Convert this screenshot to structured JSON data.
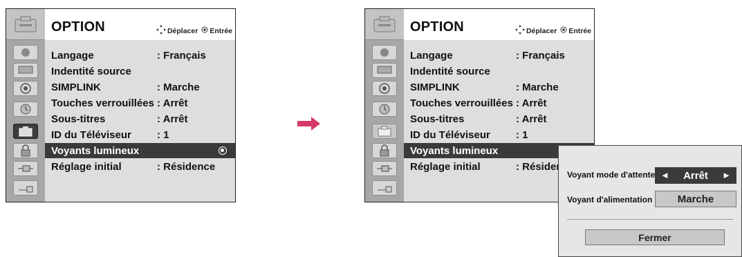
{
  "menu": {
    "title": "OPTION",
    "hint_move": "Déplacer",
    "hint_enter": "Entrée",
    "items": [
      {
        "label": "Langage",
        "value": ": Français"
      },
      {
        "label": "Indentité source",
        "value": ""
      },
      {
        "label": "SIMPLINK",
        "value": ": Marche"
      },
      {
        "label": "Touches verrouillées",
        "value": ": Arrêt"
      },
      {
        "label": "Sous-titres",
        "value": ": Arrêt"
      },
      {
        "label": "ID du Téléviseur",
        "value": ": 1"
      },
      {
        "label": "Voyants lumineux",
        "value": ""
      },
      {
        "label": "Réglage initial",
        "value": ": Résidence"
      }
    ],
    "selected_index": 6,
    "categories": [
      "picture-icon",
      "screen-icon",
      "audio-icon",
      "time-icon",
      "option-icon",
      "lock-icon",
      "input-icon",
      "usb-icon"
    ],
    "selected_category": 4
  },
  "popup": {
    "standby_label": "Voyant mode d'attente",
    "standby_value": "Arrêt",
    "power_label": "Voyant d'alimentation",
    "power_value": "Marche",
    "close_label": "Fermer"
  },
  "colors": {
    "highlight": "#3a3a3a",
    "sidebar": "#a7a7a7",
    "content_bg": "#dedede",
    "arrow": "#d63a6a"
  }
}
